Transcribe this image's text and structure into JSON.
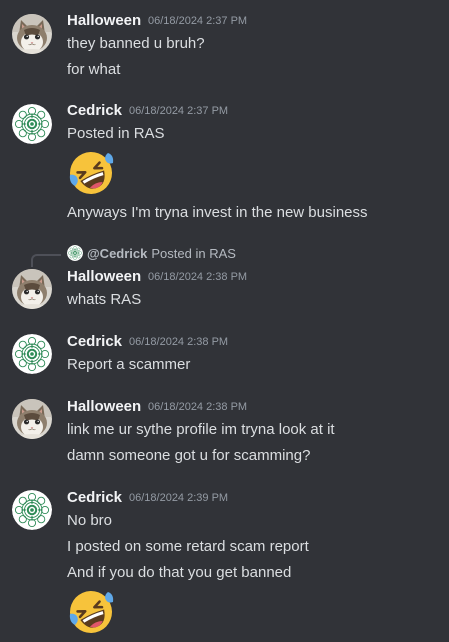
{
  "messages": [
    {
      "author": "Halloween",
      "timestamp": "06/18/2024 2:37 PM",
      "avatar_icon": "cat-avatar",
      "lines": [
        "they banned u bruh?",
        "for what"
      ]
    },
    {
      "author": "Cedrick",
      "timestamp": "06/18/2024 2:37 PM",
      "avatar_icon": "mandala-avatar",
      "lines": [
        "Posted in RAS",
        "Anyways I'm tryna invest in the new business"
      ],
      "emoji": "rolling-on-the-floor-laughing-emoji"
    },
    {
      "author": "Halloween",
      "timestamp": "06/18/2024 2:38 PM",
      "avatar_icon": "cat-avatar",
      "reply": {
        "author": "@Cedrick",
        "text": "Posted in RAS"
      },
      "lines": [
        "whats RAS"
      ]
    },
    {
      "author": "Cedrick",
      "timestamp": "06/18/2024 2:38 PM",
      "avatar_icon": "mandala-avatar",
      "lines": [
        "Report a scammer"
      ]
    },
    {
      "author": "Halloween",
      "timestamp": "06/18/2024 2:38 PM",
      "avatar_icon": "cat-avatar",
      "lines": [
        "link me ur sythe profile im tryna look at it",
        "damn someone got u for scamming?"
      ]
    },
    {
      "author": "Cedrick",
      "timestamp": "06/18/2024 2:39 PM",
      "avatar_icon": "mandala-avatar",
      "lines": [
        "No bro",
        "I posted on some retard scam report",
        "And if you do that you get banned"
      ],
      "emoji": "rolling-on-the-floor-laughing-emoji"
    }
  ],
  "colors": {
    "background": "#313338",
    "author": "#f2f3f5",
    "text": "#dbdee1",
    "timestamp": "#949ba4",
    "reply_line": "#4e5058",
    "emoji_face": "#f7c33b",
    "emoji_tear": "#5fa8e8",
    "mandala": "#2e8b57"
  }
}
